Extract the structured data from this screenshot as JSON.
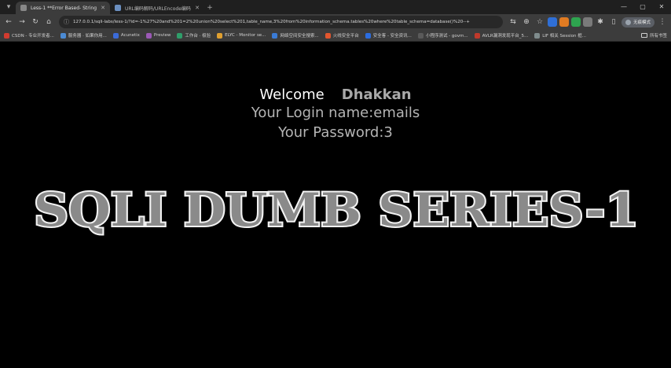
{
  "tabs": [
    {
      "title": "Less-1 **Error Based- String**",
      "active": true
    },
    {
      "title": "URL编码解码/URLEncode编码",
      "active": false
    }
  ],
  "address": {
    "url": "127.0.0.1/sqli-labs/less-1/?id=-1%27%20and%201=2%20union%20select%201,table_name,3%20from%20information_schema.tables%20where%20table_schema=database()%20--+"
  },
  "profile": {
    "label": "无痕模式"
  },
  "bookmarks": [
    {
      "label": "CSDN - 专业开发者...",
      "color": "#d23b2f"
    },
    {
      "label": "服务器 · 如果你用...",
      "color": "#4b8bd4"
    },
    {
      "label": "Acunetix",
      "color": "#3b6bd8"
    },
    {
      "label": "Preview",
      "color": "#9b59b6"
    },
    {
      "label": "工作台 · 极验",
      "color": "#2f9e6a"
    },
    {
      "label": "ELYC - Monitor se...",
      "color": "#e0a030"
    },
    {
      "label": "网络空间安全搜索...",
      "color": "#3a7bd5"
    },
    {
      "label": "火线安全平台",
      "color": "#e2562e"
    },
    {
      "label": "安全客 - 安全资讯...",
      "color": "#2b6de0"
    },
    {
      "label": "小程序测试 - govm...",
      "color": "#5a5a5a"
    },
    {
      "label": "AVLR漏洞发现平台_5...",
      "color": "#c0392b"
    },
    {
      "label": "LIF 相关 Session 框...",
      "color": "#7f8c8d"
    }
  ],
  "bookmarks_folder": {
    "label": "所有书签"
  },
  "page": {
    "welcome": "Welcome",
    "brand": "Dhakkan",
    "login": "Your Login name:emails",
    "password": "Your Password:3",
    "banner": "SQLI DUMB SERIES-1"
  }
}
